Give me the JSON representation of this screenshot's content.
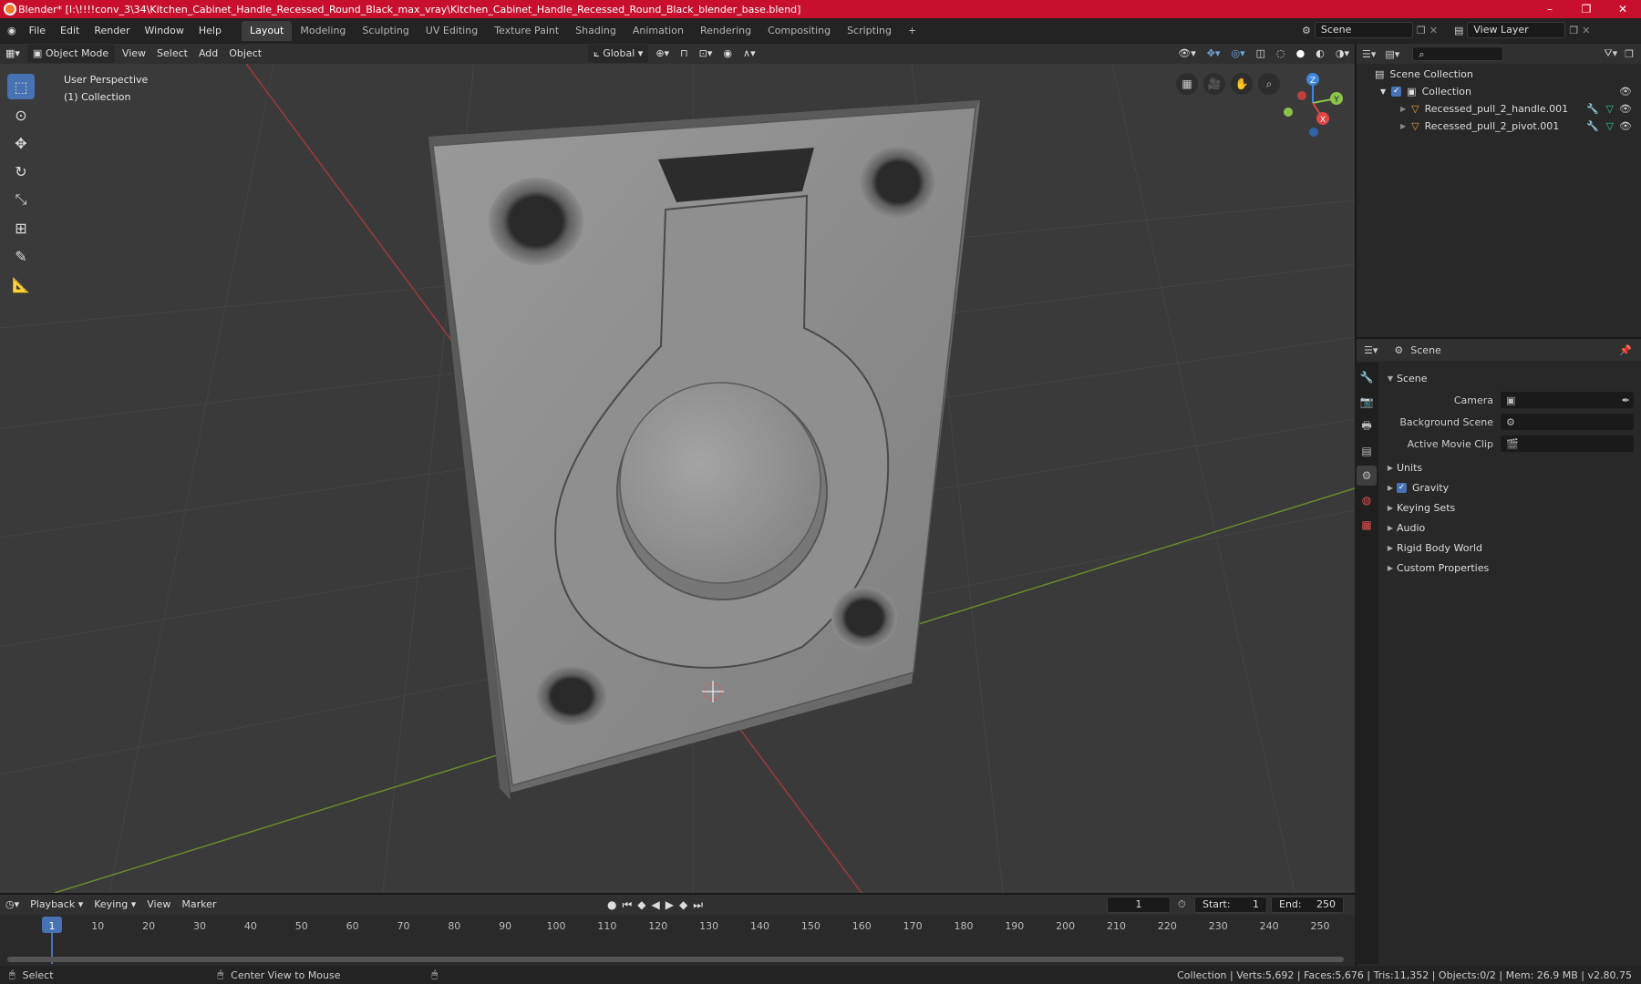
{
  "window": {
    "title": "Blender* [I:\\!!!!conv_3\\34\\Kitchen_Cabinet_Handle_Recessed_Round_Black_max_vray\\Kitchen_Cabinet_Handle_Recessed_Round_Black_blender_base.blend]",
    "minimize": "–",
    "maximize": "❐",
    "close": "✕"
  },
  "menu": [
    "File",
    "Edit",
    "Render",
    "Window",
    "Help"
  ],
  "workspaces": [
    {
      "label": "Layout",
      "active": true
    },
    {
      "label": "Modeling"
    },
    {
      "label": "Sculpting"
    },
    {
      "label": "UV Editing"
    },
    {
      "label": "Texture Paint"
    },
    {
      "label": "Shading"
    },
    {
      "label": "Animation"
    },
    {
      "label": "Rendering"
    },
    {
      "label": "Compositing"
    },
    {
      "label": "Scripting"
    }
  ],
  "add_workspace": "+",
  "scene_selector": "Scene",
  "view_layer": "View Layer",
  "viewport_header": {
    "mode": "Object Mode",
    "menus": [
      "View",
      "Select",
      "Add",
      "Object"
    ],
    "orientation": "Global"
  },
  "viewport": {
    "perspective": "User Perspective",
    "collection": "(1) Collection",
    "gizmo_axes": {
      "x": "X",
      "y": "Y",
      "z": "Z"
    }
  },
  "outliner": {
    "root": "Scene Collection",
    "collection": "Collection",
    "objects": [
      "Recessed_pull_2_handle.001",
      "Recessed_pull_2_pivot.001"
    ]
  },
  "properties": {
    "header": "Scene",
    "section": "Scene",
    "rows": [
      {
        "label": "Camera"
      },
      {
        "label": "Background Scene"
      },
      {
        "label": "Active Movie Clip"
      }
    ],
    "panels": [
      "Units",
      "Gravity",
      "Keying Sets",
      "Audio",
      "Rigid Body World",
      "Custom Properties"
    ],
    "gravity_checked": true
  },
  "timeline": {
    "menus": [
      "Playback",
      "Keying",
      "View",
      "Marker"
    ],
    "current_frame": "1",
    "start_label": "Start:",
    "start": "1",
    "end_label": "End:",
    "end": "250",
    "ticks": [
      "1",
      "10",
      "20",
      "30",
      "40",
      "50",
      "60",
      "70",
      "80",
      "90",
      "100",
      "110",
      "120",
      "130",
      "140",
      "150",
      "160",
      "170",
      "180",
      "190",
      "200",
      "210",
      "220",
      "230",
      "240",
      "250"
    ]
  },
  "status": {
    "left": "Select",
    "middle": "Center View to Mouse",
    "right": "Collection | Verts:5,692 | Faces:5,676 | Tris:11,352 | Objects:0/2 | Mem: 26.9 MB | v2.80.75"
  },
  "colors": {
    "titlebar": "#c8102e",
    "accent": "#4772b3",
    "viewport_bg": "#3a3a3a",
    "panel_bg": "#282828",
    "x_axis": "#e04545",
    "y_axis": "#8bc34a",
    "z_axis": "#3f86e0",
    "object_icon": "#e59a4a"
  }
}
